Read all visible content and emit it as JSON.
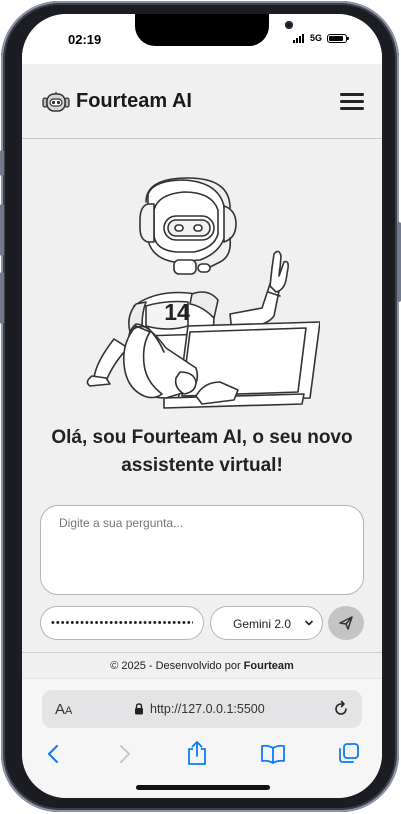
{
  "status_bar": {
    "time": "02:19",
    "network": "5G",
    "battery_level": 0.85
  },
  "app": {
    "title": "Fourteam AI",
    "mascot_jersey_number": "14",
    "welcome_text": "Olá, sou Fourteam AI, o seu novo assistente virtual!"
  },
  "chat": {
    "prompt_placeholder": "Digite a sua pergunta...",
    "api_key_value": "••••••••••••••••••••••••••••••••",
    "model_selected": "Gemini 2.0",
    "send_icon": "send-icon"
  },
  "footer": {
    "prefix": "© 2025 - Desenvolvido por ",
    "brand": "Fourteam"
  },
  "browser": {
    "text_size_label_big": "A",
    "text_size_label_small": "A",
    "url": "http://127.0.0.1:5500",
    "accent_color": "#0a7aff"
  },
  "icons": [
    "robot-logo-icon",
    "menu-icon",
    "lock-icon",
    "reload-icon",
    "back-icon",
    "forward-icon",
    "share-icon",
    "bookmarks-icon",
    "tabs-icon",
    "chevron-down-icon"
  ]
}
